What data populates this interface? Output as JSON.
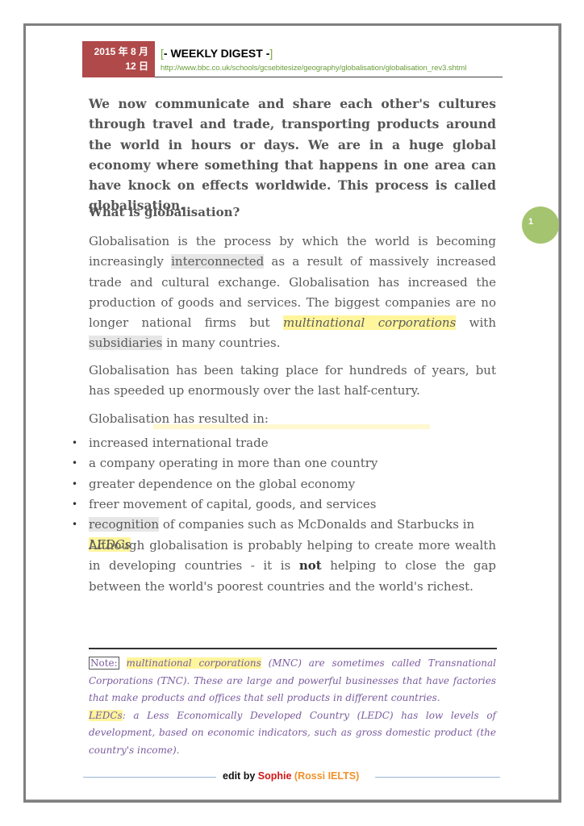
{
  "header": {
    "date_line1": "2015 年 8 月",
    "date_line2": "12 日",
    "title_open": "[",
    "title": "- WEEKLY DIGEST -",
    "title_close": "]",
    "url": "http://www.bbc.co.uk/schools/gcsebitesize/geography/globalisation/globalisation_rev3.shtml"
  },
  "page_number": "1",
  "lead": "We now communicate and share each other's cultures through travel and trade, transporting products around the world in hours or days. We are in a huge global economy where something that happens in one area can have knock on effects worldwide. This process is called globalisation.",
  "heading": "What is globalisation?",
  "para1": {
    "a": "Globalisation is the process by which the world is becoming increasingly ",
    "hl1": "interconnected",
    "b": " as a result of massively increased trade and cultural exchange. Globalisation has increased the production of goods and services. The biggest companies are no longer national firms but ",
    "hl2": "multinational corporations",
    "c": " with ",
    "hl3": "subsidiaries",
    "d": " in many countries."
  },
  "para2": "Globalisation has been taking place for hundreds of years, but has speeded up enormously over the last half-century.",
  "para3": "Globalisation has resulted in:",
  "bullets": [
    "increased international trade",
    "a company operating in more than one country",
    "greater dependence on the global economy",
    "freer movement of capital, goods, and services"
  ],
  "bullet5": {
    "hl": "recognition",
    "text": " of companies such as McDonalds and Starbucks in ",
    "hl2": "LEDCs"
  },
  "para4": {
    "a": "Although globalisation is probably helping to create more wealth in developing countries - it is ",
    "bold": "not",
    "b": " helping to close the gap between the world's poorest countries and the world's richest."
  },
  "note": {
    "label": "Note:",
    "term1": "multinational corporations",
    "def1": " (MNC) are sometimes called Transnational Corporations (TNC). These are large and powerful businesses that have factories that make products and offices that sell products in different countries.",
    "term2": "LEDCs",
    "def2": ": a Less Economically Developed Country (LEDC) has low levels of development, based on economic indicators, such as gross domestic product (the country's income)."
  },
  "footer": {
    "prefix": "edit by ",
    "name": "Sophie",
    "org": " (Rossi IELTS)"
  }
}
